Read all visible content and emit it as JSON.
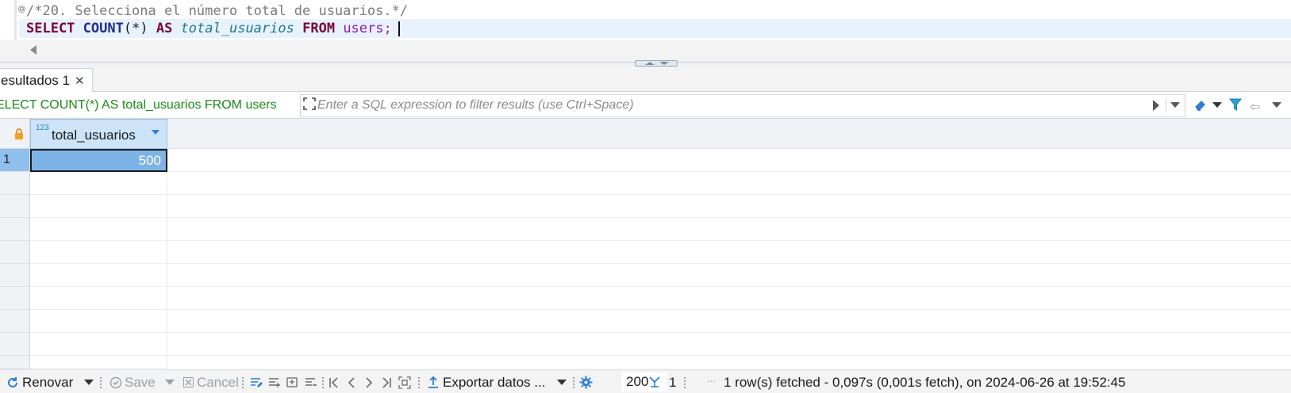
{
  "editor": {
    "comment_line": "/*20. Selecciona el número total de usuarios.*/",
    "kw_select": "SELECT",
    "fn_count": "COUNT",
    "paren_star": "(*)",
    "kw_as": "AS",
    "alias": "total_usuarios",
    "kw_from": "FROM",
    "table": "users",
    "semicolon": ";",
    "fold_symbol": "⊖"
  },
  "results_tab": {
    "label": "esultados 1",
    "close_symbol": "✕"
  },
  "filter_bar": {
    "query_text": "ELECT COUNT(*) AS total_usuarios FROM users",
    "filter_placeholder": "Enter a SQL expression to filter results (use Ctrl+Space)",
    "back_symbol": "⇦"
  },
  "grid": {
    "column": {
      "type_badge": "123",
      "name": "total_usuarios"
    },
    "rows": [
      {
        "num": "1",
        "value": "500"
      }
    ]
  },
  "status_bar": {
    "refresh_label": "Renovar",
    "save_label": "Save",
    "cancel_label": "Cancel",
    "export_label": "Exportar datos ...",
    "fetch_size": "200",
    "row_count": "1",
    "ellipsis": "...",
    "status_message": "1 row(s) fetched - 0,097s (0,001s fetch), on 2024-06-26 at 19:52:45"
  },
  "colors": {
    "selection": "#7db3e6",
    "query_green": "#1a8a1a",
    "keyword": "#7f0033",
    "accent_blue": "#2a7fd4"
  }
}
